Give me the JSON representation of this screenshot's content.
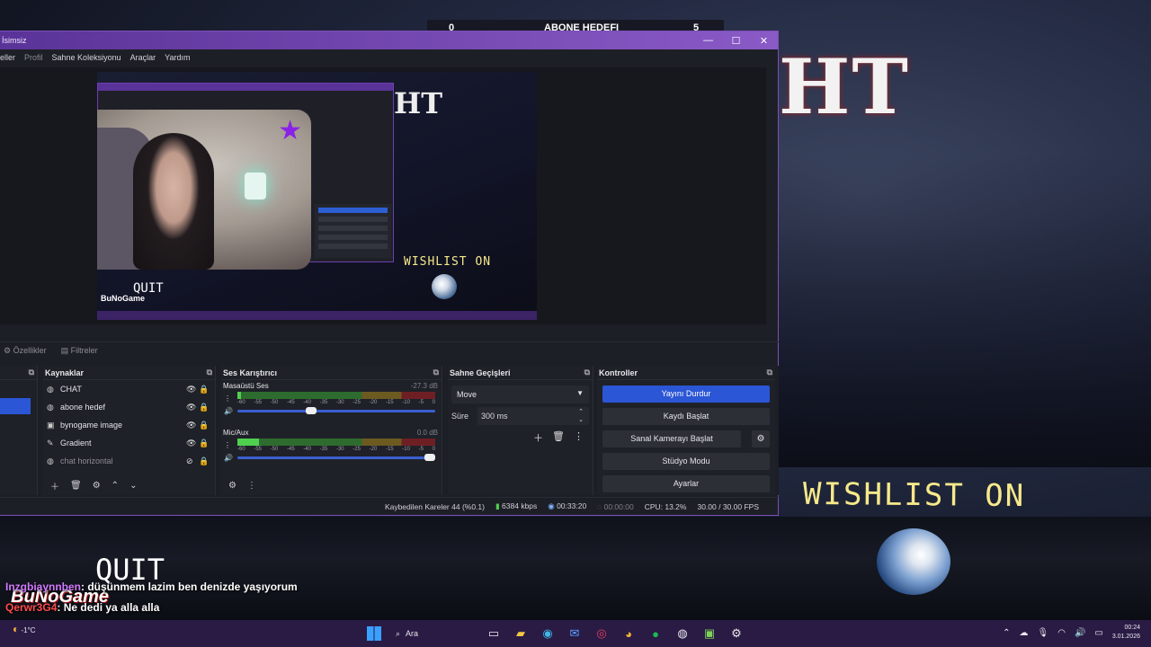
{
  "overlay": {
    "sub_goal_label": "ABONE HEDEFI",
    "sub_current": "0",
    "sub_target": "5",
    "game_title_fragment": "HT",
    "wishlist_text": "WISHLIST ON",
    "quit_text": "QUIT",
    "brand": "BuNoGame",
    "chat": [
      {
        "user": "Inzgbiaynnben",
        "message": ": düşünmem lazim ben denizde yaşıyorum"
      },
      {
        "user": "Qerwr3G4",
        "message": ": Ne dedi ya alla alla"
      }
    ]
  },
  "obs": {
    "title": "İsimsiz",
    "window_buttons": {
      "minimize": "—",
      "maximize": "☐",
      "close": "✕"
    },
    "menu": [
      "eller",
      "Profil",
      "Sahne Koleksiyonu",
      "Araçlar",
      "Yardım"
    ],
    "preview_wishlist": "WISHLIST ON",
    "preview_quit": "QUIT",
    "preview_brand": "BuNoGame",
    "preview_title": "HT",
    "props": {
      "properties": "Özellikler",
      "filters": "Filtreler"
    },
    "sources": {
      "header": "Kaynaklar",
      "items": [
        {
          "name": "CHAT",
          "icon": "globe-icon",
          "visible": true
        },
        {
          "name": "abone hedef",
          "icon": "globe-icon",
          "visible": true
        },
        {
          "name": "bynogame image",
          "icon": "image-icon",
          "visible": true
        },
        {
          "name": "Gradient",
          "icon": "brush-icon",
          "visible": true
        },
        {
          "name": "chat horizontal",
          "icon": "globe-icon",
          "visible": false
        }
      ]
    },
    "mixer": {
      "header": "Ses Karıştırıcı",
      "channels": [
        {
          "name": "Masaüstü Ses",
          "db": "-27.3 dB",
          "level": 0.02,
          "volume": 0.4
        },
        {
          "name": "Mic/Aux",
          "db": "0.0 dB",
          "level": 0.11,
          "volume": 1.0
        }
      ],
      "ticks": [
        "-60",
        "-55",
        "-50",
        "-45",
        "-40",
        "-35",
        "-30",
        "-25",
        "-20",
        "-15",
        "-10",
        "-5",
        "0"
      ]
    },
    "transitions": {
      "header": "Sahne Geçişleri",
      "selected": "Move",
      "duration_label": "Süre",
      "duration_value": "300 ms"
    },
    "controls": {
      "header": "Kontroller",
      "buttons": [
        "Yayını Durdur",
        "Kaydı Başlat",
        "Sanal Kamerayı Başlat",
        "Stüdyo Modu",
        "Ayarlar"
      ]
    },
    "status": {
      "dropped": "Kaybedilen Kareler 44 (%0.1)",
      "bitrate": "6384 kbps",
      "stream_time": "00:33:20",
      "rec_time": "00:00:00",
      "cpu": "CPU: 13.2%",
      "fps": "30.00 / 30.00 FPS"
    }
  },
  "taskbar": {
    "weather_temp": "-1°C",
    "search_label": "Ara",
    "time": "00:24",
    "date": "3.01.2026"
  },
  "colors": {
    "accent": "#2b56d6",
    "obs_frame": "#7b4fb8",
    "wishlist": "#f6e98a",
    "taskbar": "#2a1b45"
  }
}
